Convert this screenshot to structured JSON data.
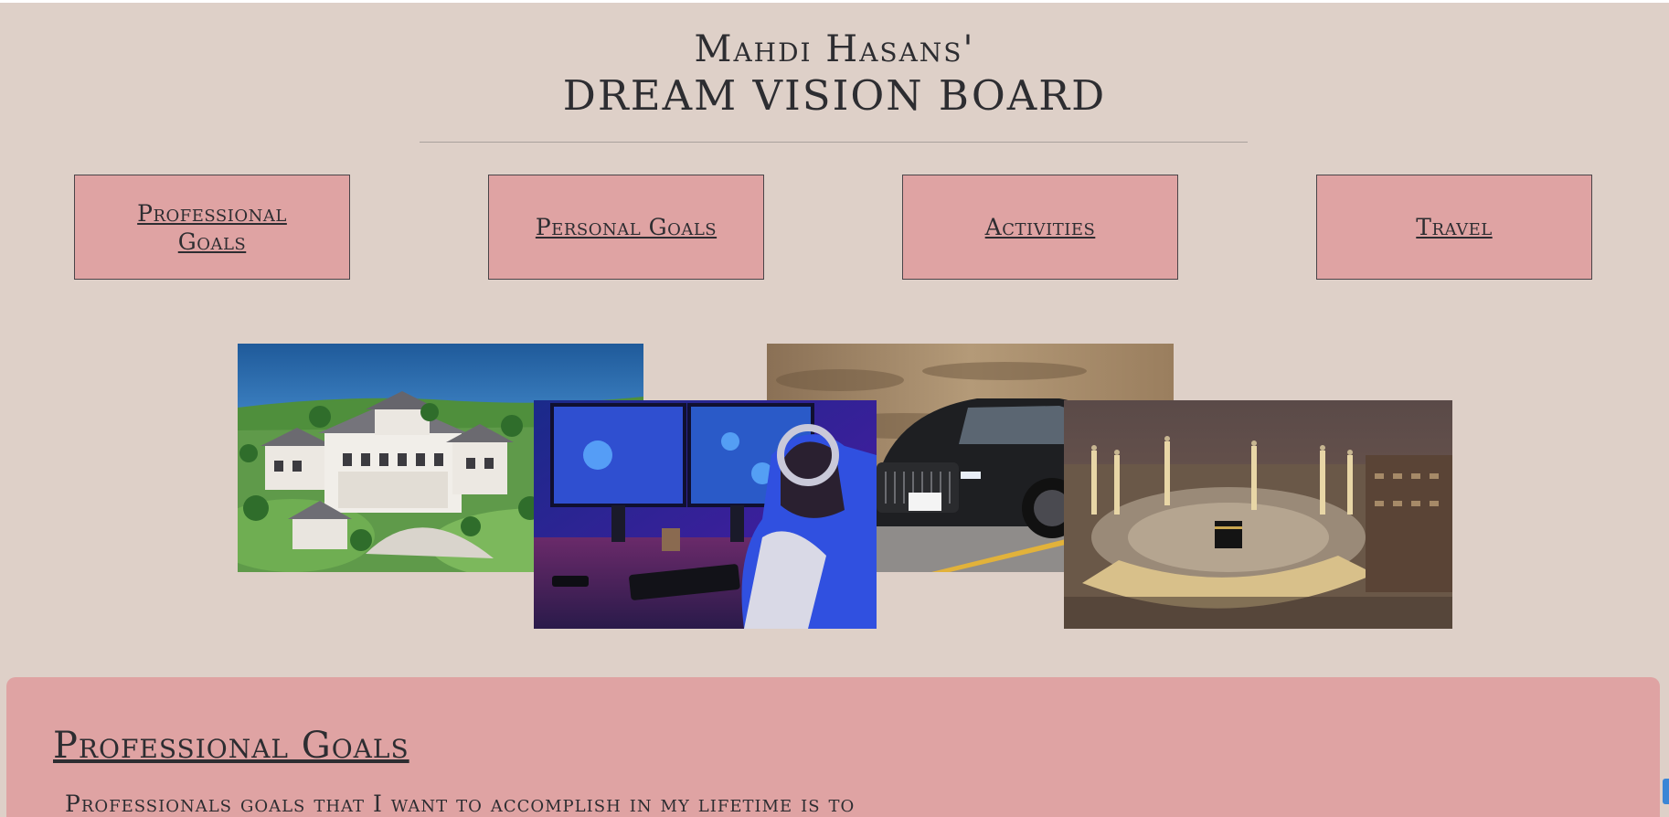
{
  "header": {
    "title_line1": "Mahdi Hasans'",
    "title_line2": "DREAM VISION BOARD"
  },
  "nav": {
    "buttons": [
      {
        "label": "Professional Goals"
      },
      {
        "label": "Personal Goals"
      },
      {
        "label": "Activities"
      },
      {
        "label": "Travel"
      }
    ]
  },
  "gallery": {
    "images": [
      {
        "subject": "luxury mansion by a lake",
        "icon": "mansion-photo"
      },
      {
        "subject": "gamer at a gaming setup",
        "icon": "gaming-photo"
      },
      {
        "subject": "black luxury car on a road",
        "icon": "car-photo"
      },
      {
        "subject": "Masjid al-Haram in Mecca at night",
        "icon": "mecca-photo"
      }
    ]
  },
  "section": {
    "title": "Professional Goals",
    "text": "Professionals goals that I want to accomplish in my lifetime is to"
  },
  "colors": {
    "page_background": "#ded0c8",
    "button_background": "#dfa3a3",
    "text": "#2d2d31"
  }
}
